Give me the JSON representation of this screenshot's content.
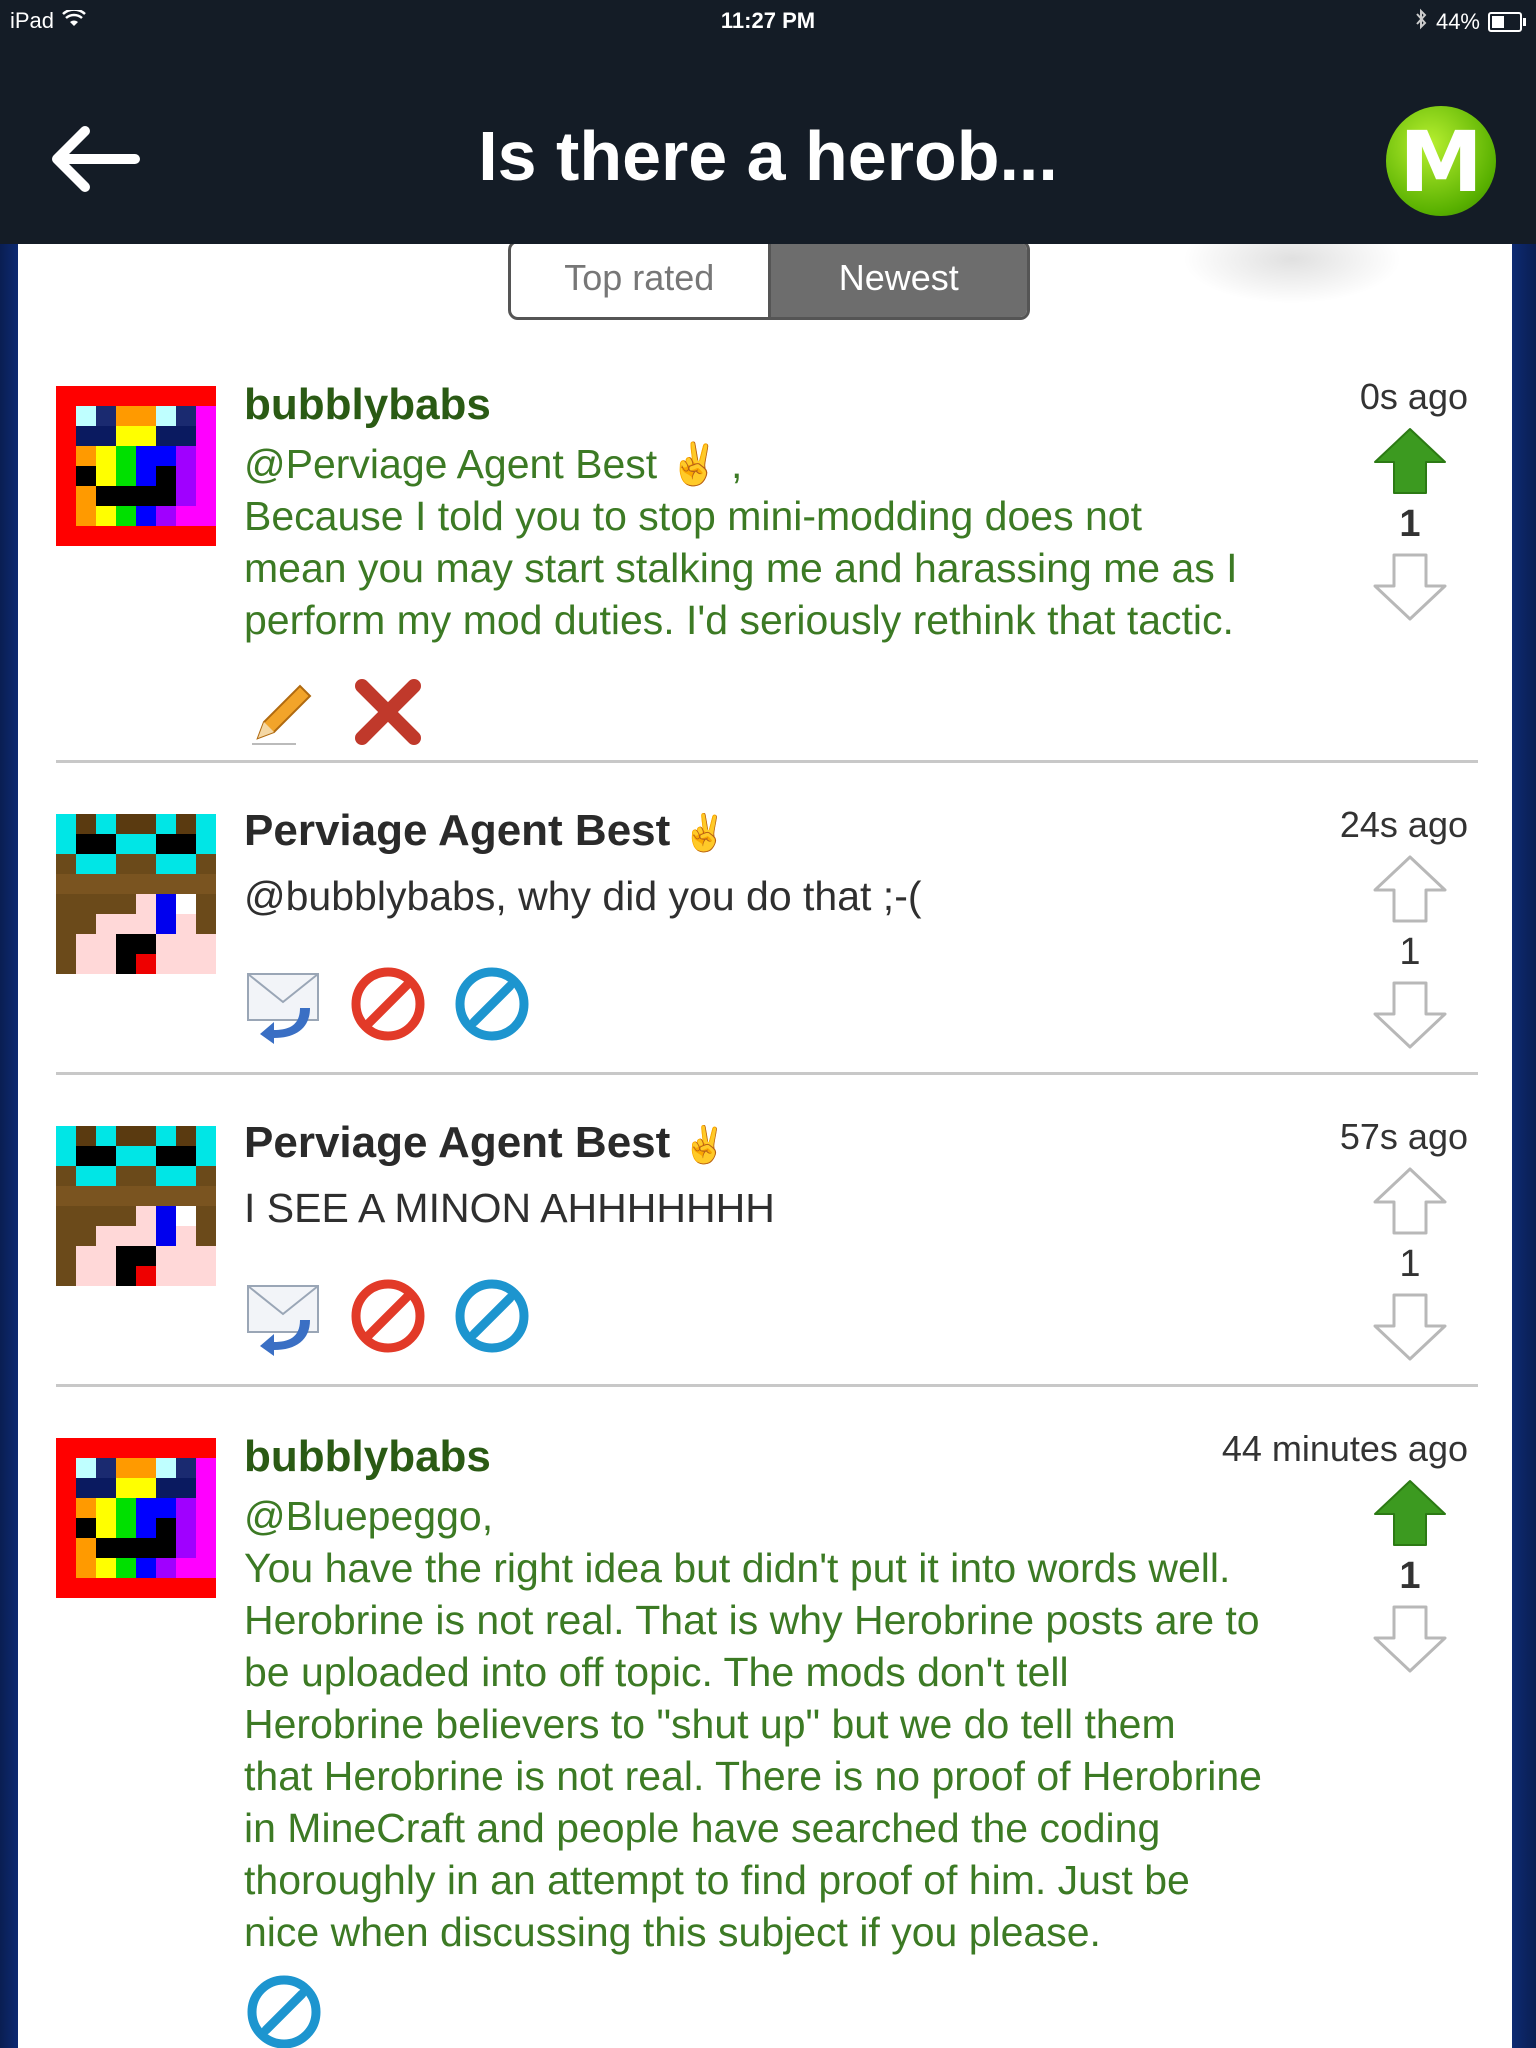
{
  "status_bar": {
    "device": "iPad",
    "time": "11:27 PM",
    "battery": "44%",
    "battery_level": 0.44,
    "wifi_icon": "wifi-icon",
    "bluetooth_icon": "bluetooth-icon"
  },
  "nav": {
    "back_icon": "arrow-left-icon",
    "title": "Is there a herob...",
    "logo_letter": "M"
  },
  "tabs": [
    {
      "label": "Top rated",
      "active": false
    },
    {
      "label": "Newest",
      "active": true
    }
  ],
  "posts": [
    {
      "username": "bubblybabs",
      "role": "moderator",
      "avatar": "rainbow-pixel-avatar",
      "badge_icon": "",
      "time": "0s ago",
      "votes": "1",
      "upvoted": true,
      "lines": [
        "@Perviage Agent Best ✌ ,",
        "Because I told you to stop mini-modding does not",
        "mean you may start stalking me and harassing me as I",
        "perform my mod duties. I'd seriously rethink that tactic."
      ],
      "actions": [
        "pencil-icon",
        "x-delete-icon"
      ]
    },
    {
      "username": "Perviage Agent Best",
      "role": "user",
      "avatar": "pixel-face-avatar",
      "badge_icon": "✌",
      "time": "24s ago",
      "votes": "1",
      "upvoted": false,
      "lines": [
        "@bubblybabs, why did you do that ;-("
      ],
      "actions": [
        "reply-mail-icon",
        "block-red-icon",
        "block-blue-icon"
      ]
    },
    {
      "username": "Perviage Agent Best",
      "role": "user",
      "avatar": "pixel-face-avatar",
      "badge_icon": "✌",
      "time": "57s ago",
      "votes": "1",
      "upvoted": false,
      "lines": [
        "I SEE A MINON AHHHHHHH"
      ],
      "actions": [
        "reply-mail-icon",
        "block-red-icon",
        "block-blue-icon"
      ]
    },
    {
      "username": "bubblybabs",
      "role": "moderator",
      "avatar": "rainbow-pixel-avatar",
      "badge_icon": "",
      "time": "44 minutes ago",
      "votes": "1",
      "upvoted": true,
      "lines": [
        "@Bluepeggo,",
        "You have the right idea but didn't put it into words well.",
        "Herobrine is not real. That is why Herobrine posts are to",
        "be uploaded into off topic. The mods don't tell",
        "Herobrine believers to \"shut up\" but we do tell them",
        "that Herobrine is not real. There is no proof of Herobrine",
        "in MineCraft and people have searched the coding",
        "thoroughly in an attempt to find proof of him. Just be",
        "nice when discussing this subject if you please."
      ],
      "actions": [
        "block-blue-icon"
      ]
    }
  ],
  "colors": {
    "nav_bg": "#141c26",
    "mod_name": "#2a5a14",
    "mod_text": "#3c7a24",
    "upvote_green": "#3c9a20",
    "segment_active": "#6d6d6d"
  }
}
